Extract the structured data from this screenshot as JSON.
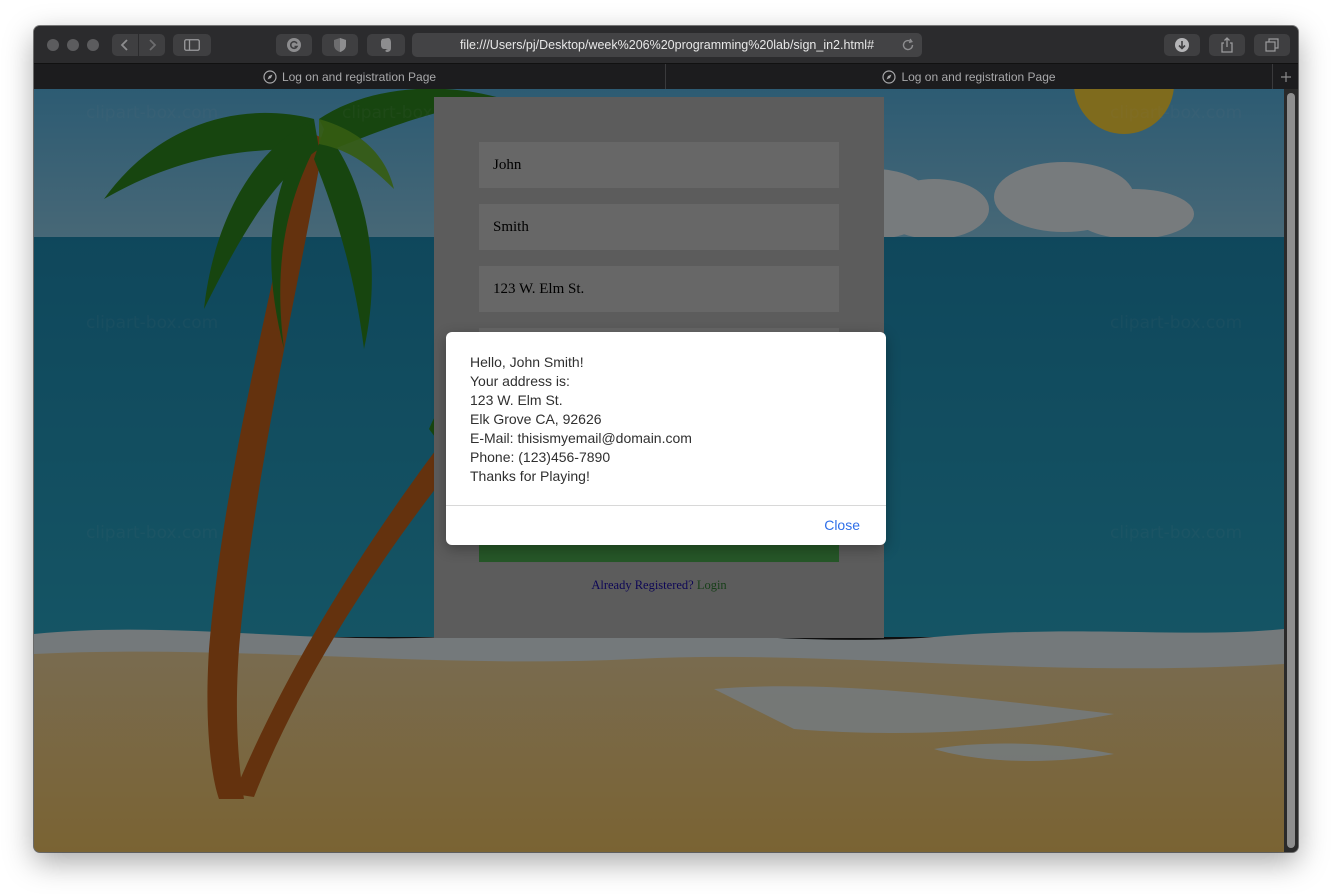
{
  "browser": {
    "url": "file:///Users/pj/Desktop/week%206%20programming%20lab/sign_in2.html#",
    "tabs": [
      {
        "label": "Log on and registration Page"
      },
      {
        "label": "Log on and registration Page"
      }
    ]
  },
  "form": {
    "first_name": "John",
    "last_name": "Smith",
    "address": "123 W. Elm St.",
    "already_registered": "Already Registered?",
    "login_link": "Login"
  },
  "background": {
    "watermark": "clipart-box.com"
  },
  "dialog": {
    "lines": [
      "Hello, John Smith!",
      "Your address is:",
      "123 W. Elm St.",
      "Elk Grove CA, 92626",
      "E-Mail: thisismyemail@domain.com",
      "Phone: (123)456-7890",
      "Thanks for Playing!"
    ],
    "close_label": "Close"
  },
  "colors": {
    "accent_link": "#2f6fe8",
    "submit_green": "#4caf50"
  }
}
